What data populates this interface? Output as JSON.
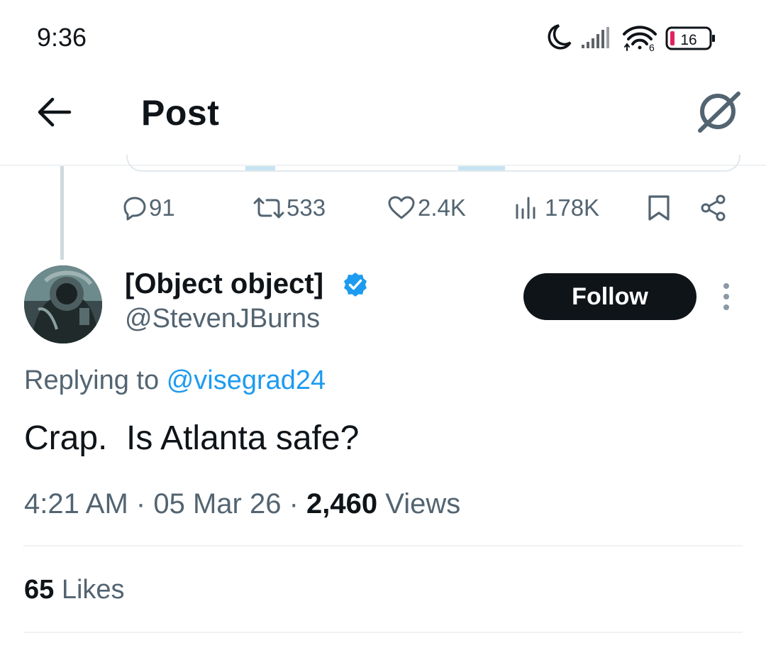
{
  "status_bar": {
    "time": "9:36",
    "battery": "16",
    "wifi_badge": "6"
  },
  "header": {
    "title": "Post"
  },
  "actions": {
    "replies": "91",
    "reposts": "533",
    "likes": "2.4K",
    "views": "178K"
  },
  "reply": {
    "display_name": "[Object object]",
    "handle": "@StevenJBurns",
    "follow_label": "Follow",
    "replying_prefix": "Replying to",
    "replying_handle": "@visegrad24",
    "text": "Crap.  Is Atlanta safe?",
    "time": "4:21 AM",
    "date": "05 Mar 26",
    "views_count": "2,460",
    "views_label": "Views",
    "likes_count": "65",
    "likes_label": "Likes"
  },
  "icons": {
    "status": [
      "moon-icon",
      "signal-icon",
      "wifi-icon",
      "battery-icon"
    ],
    "header": [
      "back-arrow-icon",
      "grok-icon"
    ],
    "actions": [
      "reply-icon",
      "repost-icon",
      "like-icon",
      "views-icon",
      "bookmark-icon",
      "share-icon"
    ],
    "author": [
      "verified-badge-icon",
      "more-options-icon"
    ]
  },
  "colors": {
    "text_primary": "#0f1419",
    "text_secondary": "#536471",
    "link": "#1d9bf0",
    "verified": "#1d9bf0",
    "battery_low": "#e0245e",
    "follow_bg": "#0f1419"
  }
}
